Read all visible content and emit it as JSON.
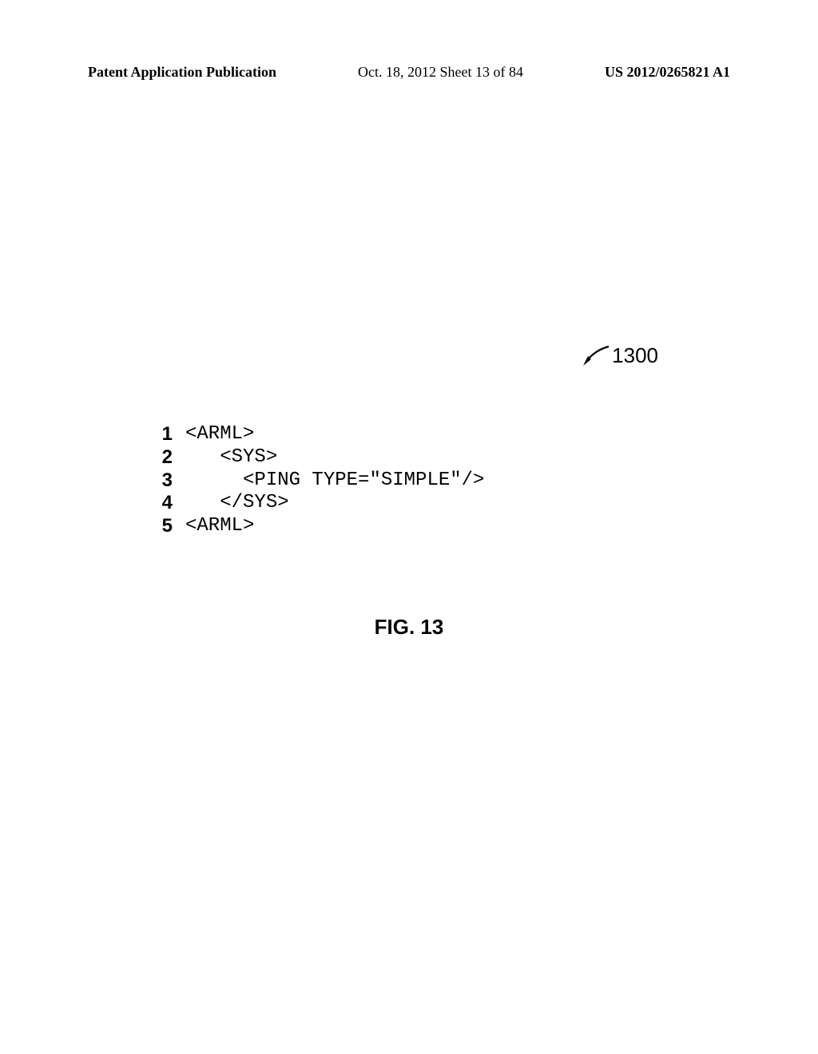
{
  "header": {
    "left": "Patent Application Publication",
    "center": "Oct. 18, 2012  Sheet 13 of 84",
    "right": "US 2012/0265821 A1"
  },
  "figure_ref": "1300",
  "code": {
    "lines": [
      {
        "num": "1",
        "text": "<ARML>"
      },
      {
        "num": "2",
        "text": "   <SYS>"
      },
      {
        "num": "3",
        "text": "     <PING TYPE=\"SIMPLE\"/>"
      },
      {
        "num": "4",
        "text": "   </SYS>"
      },
      {
        "num": "5",
        "text": "<ARML>"
      }
    ]
  },
  "caption": "FIG. 13"
}
